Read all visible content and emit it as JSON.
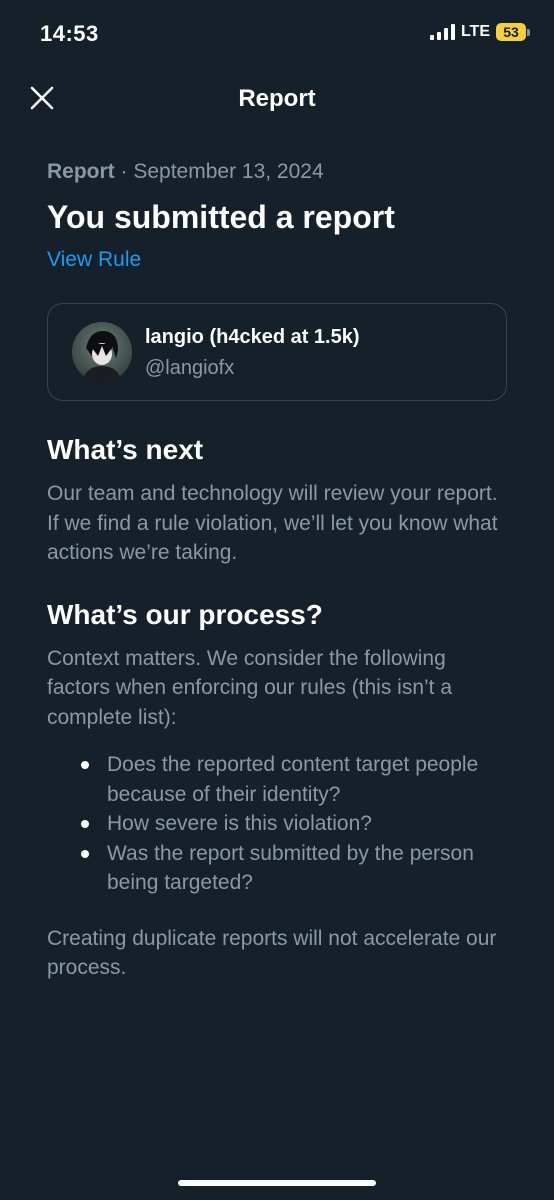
{
  "status_bar": {
    "time": "14:53",
    "network": "LTE",
    "battery": "53",
    "battery_color": "#f2cf3e"
  },
  "nav": {
    "title": "Report",
    "close_icon": "close-icon"
  },
  "report": {
    "type_label": "Report",
    "separator": " · ",
    "date": "September 13, 2024",
    "headline": "You submitted a report",
    "view_rule_label": "View Rule"
  },
  "reported_user": {
    "name": "langio (h4cked at 1.5k)",
    "handle": "@langiofx"
  },
  "whats_next": {
    "title": "What’s next",
    "body": "Our team and technology will review your report. If we find a rule violation, we’ll let you know what actions we’re taking."
  },
  "process": {
    "title": "What’s our process?",
    "body": "Context matters. We consider the following factors when enforcing our rules (this isn’t a complete list):",
    "bullets": [
      "Does the reported content target people because of their identity?",
      "How severe is this violation?",
      "Was the report submitted by the person being targeted?"
    ],
    "closing": "Creating duplicate reports will not accelerate our process."
  },
  "colors": {
    "background": "#15202b",
    "secondary_text": "#8b98a5",
    "link": "#1d9bf0",
    "border": "#38444d"
  }
}
